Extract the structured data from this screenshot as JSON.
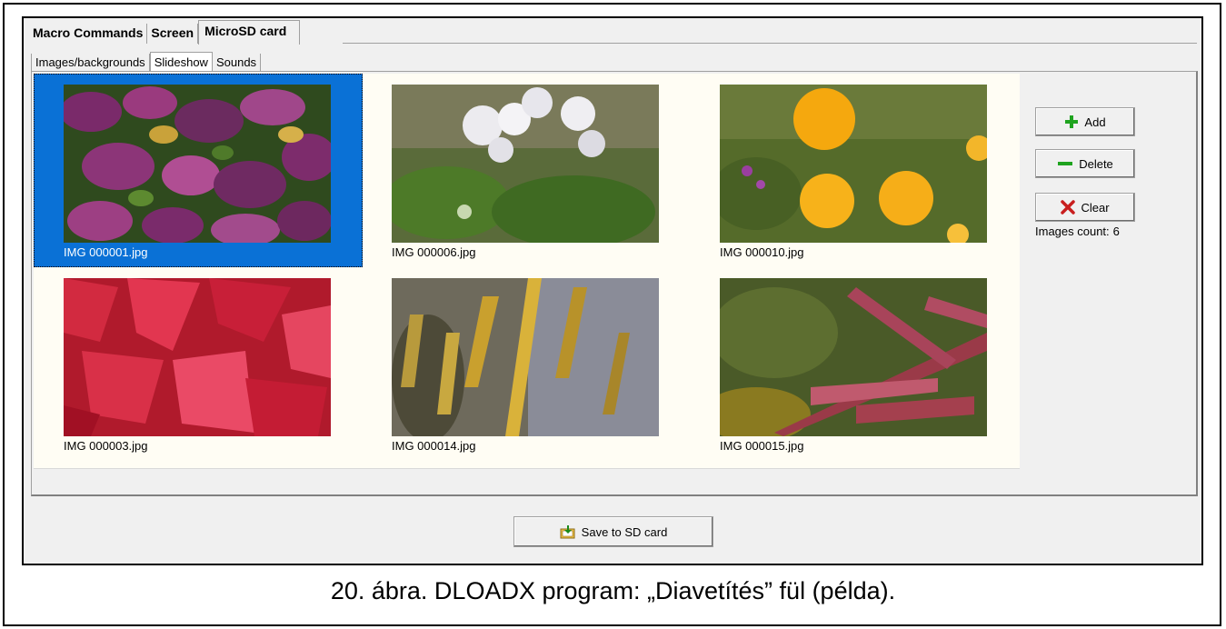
{
  "tabs": {
    "main": [
      "Macro Commands",
      "Screen",
      "MicroSD card"
    ],
    "sub": [
      "Images/backgrounds",
      "Slideshow",
      "Sounds"
    ]
  },
  "gallery": {
    "images": [
      {
        "name": "IMG 000001.jpg",
        "selected": true
      },
      {
        "name": "IMG 000006.jpg",
        "selected": false
      },
      {
        "name": "IMG 000010.jpg",
        "selected": false
      },
      {
        "name": "IMG 000003.jpg",
        "selected": false
      },
      {
        "name": "IMG 000014.jpg",
        "selected": false
      },
      {
        "name": "IMG 000015.jpg",
        "selected": false
      }
    ]
  },
  "buttons": {
    "add": "Add",
    "delete": "Delete",
    "clear": "Clear",
    "save": "Save to SD card"
  },
  "count": {
    "label": "Images count:",
    "value": "6"
  },
  "caption": "20. ábra. DLOADX program: „Diavetítés” fül (példa).",
  "colors": {
    "selection": "#0a71d6",
    "add_icon": "#1fa31f",
    "delete_icon": "#1fa31f",
    "clear_icon": "#c81e1e"
  }
}
